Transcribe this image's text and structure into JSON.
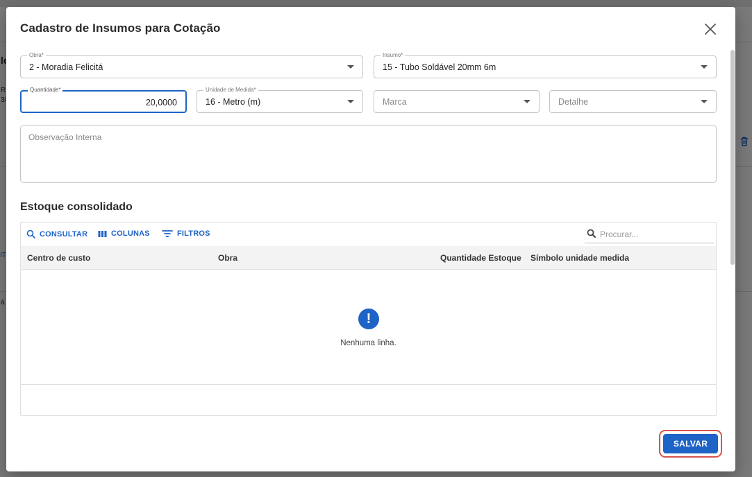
{
  "background": {
    "fragments": [
      "le",
      "R",
      "3/",
      "IT",
      "á"
    ]
  },
  "modal": {
    "title": "Cadastro de Insumos para Cotação",
    "fields": {
      "obra": {
        "label": "Obra*",
        "value": "2 - Moradia Felicitá"
      },
      "insumo": {
        "label": "Insumo*",
        "value": "15 - Tubo Soldável 20mm 6m"
      },
      "quantidade": {
        "label": "Quantidade*",
        "value": "20,0000"
      },
      "unidade": {
        "label": "Unidade de Medida*",
        "value": "16 - Metro (m)"
      },
      "marca": {
        "placeholder": "Marca"
      },
      "detalhe": {
        "placeholder": "Detalhe"
      },
      "observacao": {
        "placeholder": "Observação Interna"
      }
    },
    "stock_section": {
      "title": "Estoque consolidado",
      "toolbar": {
        "consultar": "CONSULTAR",
        "colunas": "COLUNAS",
        "filtros": "FILTROS",
        "search_placeholder": "Procurar..."
      },
      "columns": [
        "Centro de custo",
        "Obra",
        "Quantidade Estoque",
        "Símbolo unidade medida"
      ],
      "rows": [],
      "empty_message": "Nenhuma linha."
    },
    "save_label": "SALVAR"
  }
}
